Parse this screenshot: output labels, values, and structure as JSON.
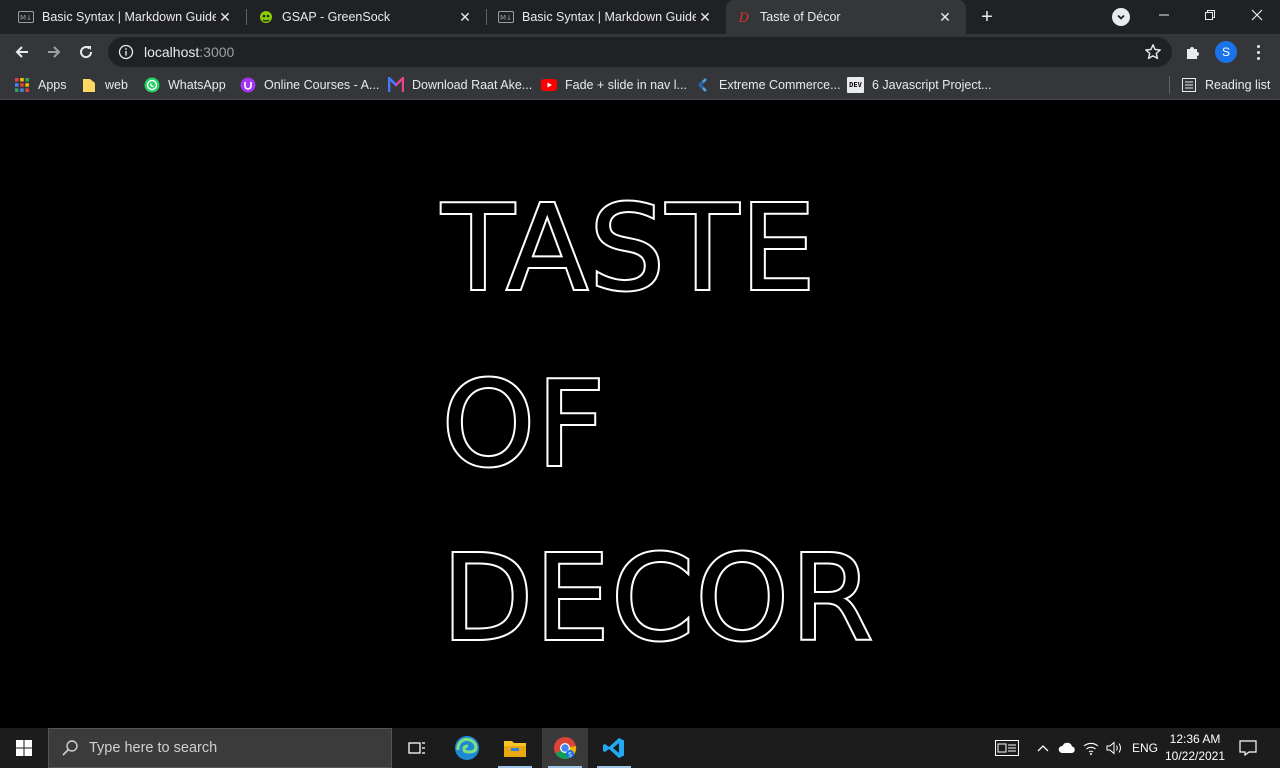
{
  "browser": {
    "tabs": [
      {
        "title": "Basic Syntax | Markdown Guide",
        "icon": "markdown-icon",
        "active": false
      },
      {
        "title": "GSAP - GreenSock",
        "icon": "greensock-icon",
        "active": false
      },
      {
        "title": "Basic Syntax | Markdown Guide",
        "icon": "markdown-icon",
        "active": false
      },
      {
        "title": "Taste of Décor",
        "icon": "decor-d-icon",
        "active": true
      }
    ],
    "tab_close_glyph": "✕",
    "new_tab_glyph": "+",
    "address": {
      "host": "localhost",
      "port": ":3000"
    },
    "profile_initial": "S",
    "bookmarks": [
      {
        "label": "Apps",
        "icon": "apps-grid-icon"
      },
      {
        "label": "web",
        "icon": "folder-icon"
      },
      {
        "label": "WhatsApp",
        "icon": "whatsapp-icon"
      },
      {
        "label": "Online Courses - A...",
        "icon": "udemy-icon"
      },
      {
        "label": "Download Raat Ake...",
        "icon": "m-logo-icon"
      },
      {
        "label": "Fade + slide in nav l...",
        "icon": "youtube-icon"
      },
      {
        "label": "Extreme Commerce...",
        "icon": "extreme-commerce-icon"
      },
      {
        "label": "6 Javascript Project...",
        "icon": "dev-icon",
        "icon_text": "DEV"
      }
    ],
    "reading_list": "Reading list"
  },
  "page": {
    "hero_lines": [
      "TASTE",
      "OF",
      "DECOR"
    ]
  },
  "taskbar": {
    "search_placeholder": "Type here to search",
    "language": "ENG",
    "time": "12:36 AM",
    "date": "10/22/2021"
  },
  "colors": {
    "tab_strip": "#202124",
    "toolbar": "#35363a",
    "page_background": "#000000",
    "hero_stroke": "#ffffff",
    "taskbar": "#1c1c1c",
    "avatar": "#1a73e8"
  }
}
